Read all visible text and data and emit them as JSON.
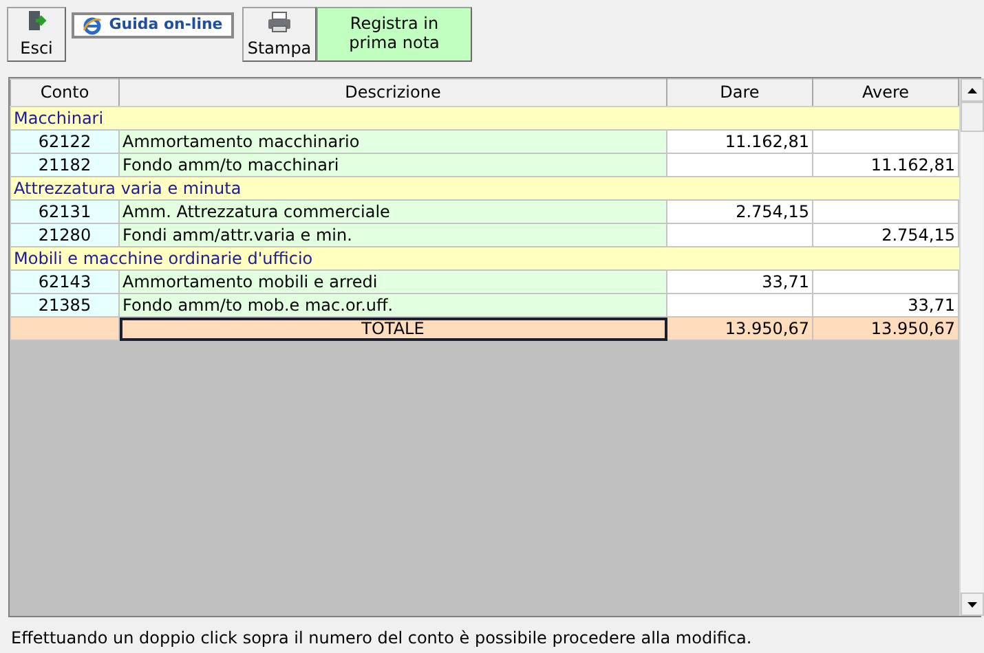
{
  "toolbar": [
    {
      "kind": "exit",
      "label": "Esci"
    },
    {
      "kind": "help",
      "label": "Guida on-line"
    },
    {
      "kind": "print",
      "label": "Stampa"
    },
    {
      "kind": "register",
      "label": "Registra in prima nota"
    }
  ],
  "table": {
    "columns": [
      "Conto",
      "Descrizione",
      "Dare",
      "Avere"
    ],
    "rows": [
      {
        "kind": "group",
        "label": "Macchinari"
      },
      {
        "kind": "entry",
        "conto": "62122",
        "descrizione": "Ammortamento macchinario",
        "dare": "11.162,81"
      },
      {
        "kind": "entry",
        "conto": "21182",
        "descrizione": "Fondo amm/to macchinari",
        "avere": "11.162,81"
      },
      {
        "kind": "group",
        "label": "Attrezzatura varia e minuta"
      },
      {
        "kind": "entry",
        "conto": "62131",
        "descrizione": "Amm. Attrezzatura commerciale",
        "dare": "2.754,15"
      },
      {
        "kind": "entry",
        "conto": "21280",
        "descrizione": "Fondi amm/attr.varia e min.",
        "avere": "2.754,15"
      },
      {
        "kind": "group",
        "label": "Mobili e macchine ordinarie d'ufficio"
      },
      {
        "kind": "entry",
        "conto": "62143",
        "descrizione": "Ammortamento mobili e arredi",
        "dare": "33,71"
      },
      {
        "kind": "entry",
        "conto": "21385",
        "descrizione": "Fondo amm/to mob.e mac.or.uff.",
        "avere": "33,71"
      },
      {
        "kind": "total",
        "descrizione": "TOTALE",
        "dare": "13.950,67",
        "avere": "13.950,67",
        "focused": true
      }
    ]
  },
  "status_text": "Effettuando un doppio click sopra il numero del conto è possibile procedere alla modifica."
}
